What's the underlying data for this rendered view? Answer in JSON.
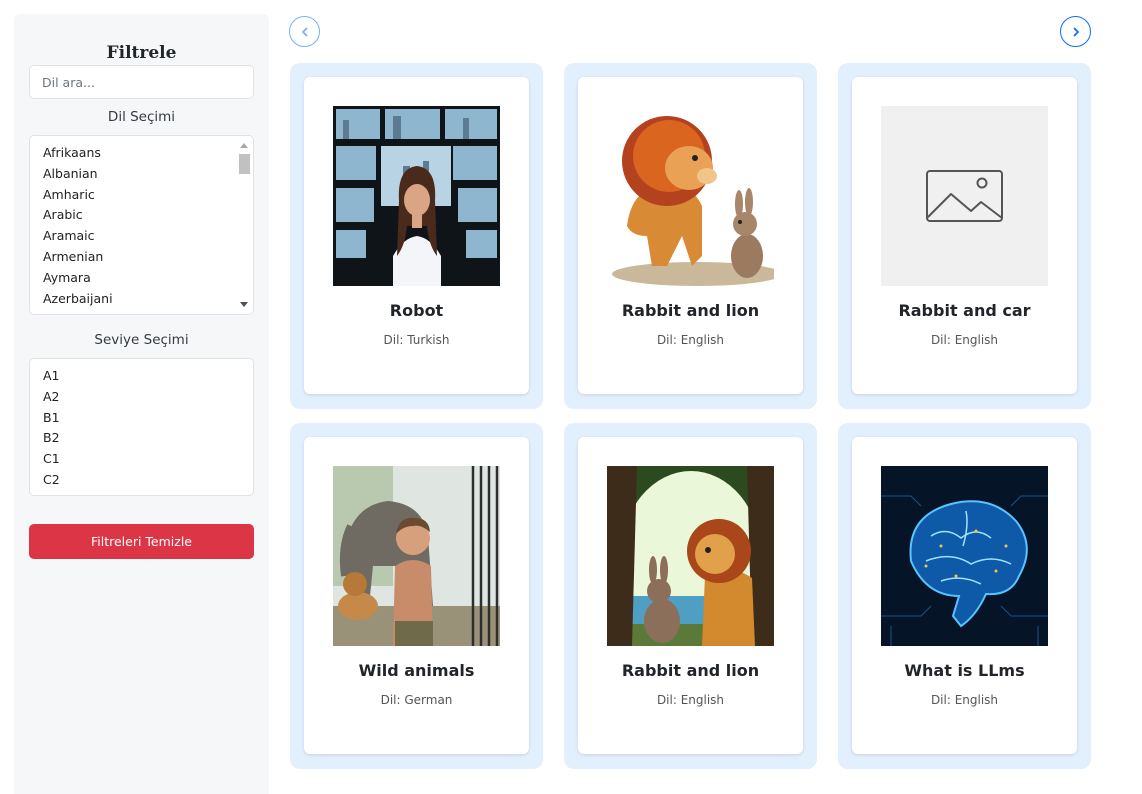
{
  "sidebar": {
    "title": "Filtrele",
    "search_placeholder": "Dil ara...",
    "language_label": "Dil Seçimi",
    "languages": [
      "Afrikaans",
      "Albanian",
      "Amharic",
      "Arabic",
      "Aramaic",
      "Armenian",
      "Aymara",
      "Azerbaijani"
    ],
    "level_label": "Seviye Seçimi",
    "levels": [
      "A1",
      "A2",
      "B1",
      "B2",
      "C1",
      "C2"
    ],
    "clear_button": "Filtreleri Temizle"
  },
  "colors": {
    "accent": "#0d6efd",
    "danger": "#dc3545",
    "card_frame": "#e2effd"
  },
  "cards": [
    {
      "title": "Robot",
      "lang": "Dil: Turkish",
      "image": "girl-city-screens"
    },
    {
      "title": "Rabbit and lion",
      "lang": "Dil: English",
      "image": "lion-rabbit-cartoon"
    },
    {
      "title": "Rabbit and car",
      "lang": "Dil: English",
      "image": "image-placeholder-icon"
    },
    {
      "title": "Wild animals",
      "lang": "Dil: German",
      "image": "boy-elephant-lion"
    },
    {
      "title": "Rabbit and lion",
      "lang": "Dil: English",
      "image": "lion-rabbit-forest"
    },
    {
      "title": "What is LLms",
      "lang": "Dil: English",
      "image": "glowing-brain-circuit"
    }
  ]
}
